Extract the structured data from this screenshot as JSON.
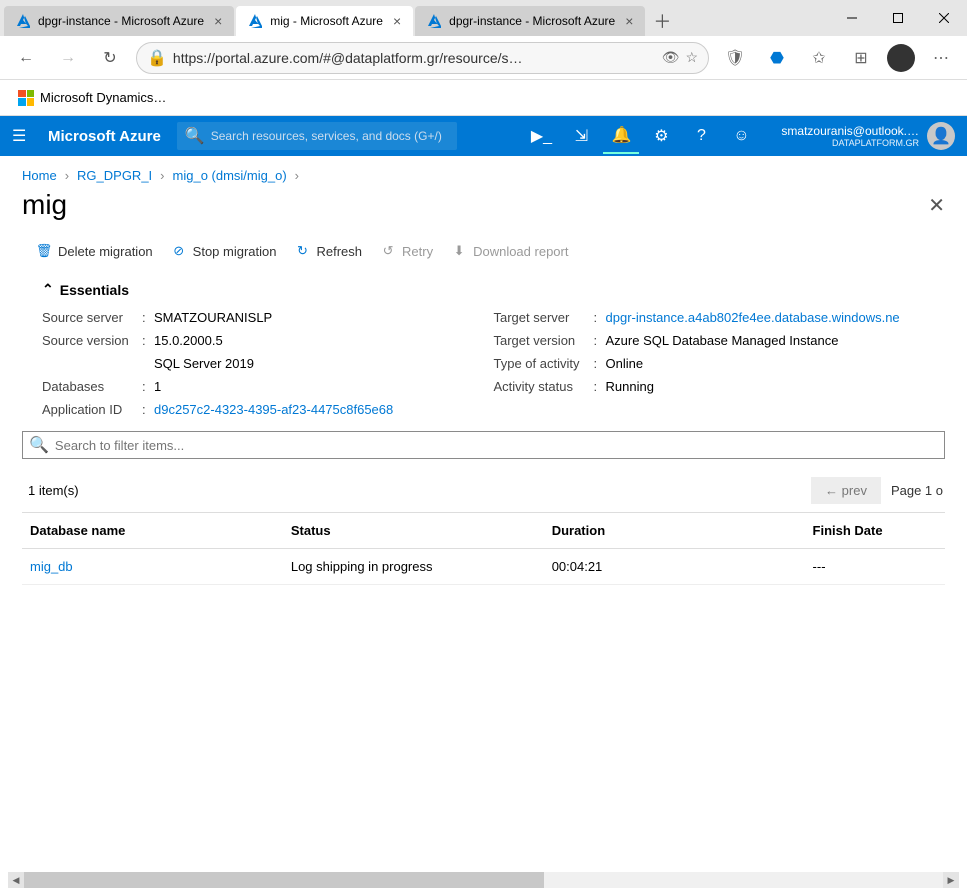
{
  "window": {
    "tabs": [
      {
        "title": "dpgr-instance - Microsoft Azure",
        "active": false
      },
      {
        "title": "mig - Microsoft Azure",
        "active": true
      },
      {
        "title": "dpgr-instance - Microsoft Azure",
        "active": false
      }
    ],
    "url": "https://portal.azure.com/#@dataplatform.gr/resource/s…"
  },
  "bookmarks": [
    {
      "label": "Microsoft Dynamics…"
    }
  ],
  "azure_header": {
    "brand": "Microsoft Azure",
    "search_placeholder": "Search resources, services, and docs (G+/)",
    "user_email": "smatzouranis@outlook.…",
    "user_org": "DATAPLATFORM.GR"
  },
  "breadcrumbs": [
    {
      "label": "Home"
    },
    {
      "label": "RG_DPGR_I"
    },
    {
      "label": "mig_o (dmsi/mig_o)"
    }
  ],
  "page_title": "mig",
  "toolbar": {
    "delete": "Delete migration",
    "stop": "Stop migration",
    "refresh": "Refresh",
    "retry": "Retry",
    "download": "Download report"
  },
  "essentials": {
    "heading": "Essentials",
    "left": {
      "source_server_label": "Source server",
      "source_server": "SMATZOURANISLP",
      "source_version_label": "Source version",
      "source_version_1": "15.0.2000.5",
      "source_version_2": "SQL Server 2019",
      "databases_label": "Databases",
      "databases": "1",
      "application_id_label": "Application ID",
      "application_id": "d9c257c2-4323-4395-af23-4475c8f65e68"
    },
    "right": {
      "target_server_label": "Target server",
      "target_server": "dpgr-instance.a4ab802fe4ee.database.windows.ne",
      "target_version_label": "Target version",
      "target_version": "Azure SQL Database Managed Instance",
      "type_activity_label": "Type of activity",
      "type_activity": "Online",
      "activity_status_label": "Activity status",
      "activity_status": "Running"
    }
  },
  "filter_placeholder": "Search to filter items...",
  "table": {
    "count_label": "1 item(s)",
    "prev_label": "← prev",
    "page_label": "Page 1 o",
    "headers": {
      "c1": "Database name",
      "c2": "Status",
      "c3": "Duration",
      "c4": "Finish Date"
    },
    "rows": [
      {
        "name": "mig_db",
        "status": "Log shipping in progress",
        "duration": "00:04:21",
        "finish": "---"
      }
    ]
  }
}
